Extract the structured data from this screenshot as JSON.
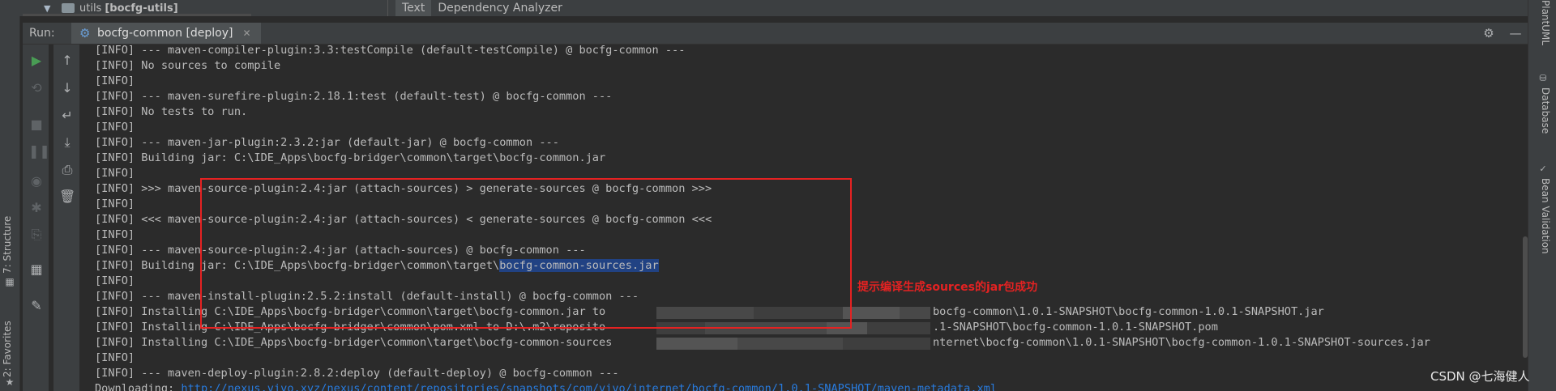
{
  "top": {
    "tree_label": "utils",
    "tree_module": "[bocfg-utils]",
    "editor_tabs": [
      "Text",
      "Dependency Analyzer"
    ]
  },
  "run": {
    "label": "Run:",
    "tab_title": "bocfg-common [deploy]"
  },
  "left_stripe": {
    "structure": "7: Structure",
    "favorites": "2: Favorites"
  },
  "right_stripe": {
    "plantuml": "PlantUML",
    "database": "Database",
    "bean_validation": "Bean Validation"
  },
  "console": {
    "lines": [
      "[INFO] --- maven-compiler-plugin:3.3:testCompile (default-testCompile) @ bocfg-common ---",
      "[INFO] No sources to compile",
      "[INFO]",
      "[INFO] --- maven-surefire-plugin:2.18.1:test (default-test) @ bocfg-common ---",
      "[INFO] No tests to run.",
      "[INFO]",
      "[INFO] --- maven-jar-plugin:2.3.2:jar (default-jar) @ bocfg-common ---",
      "[INFO] Building jar: C:\\IDE_Apps\\bocfg-bridger\\common\\target\\bocfg-common.jar",
      "[INFO]",
      "[INFO] >>> maven-source-plugin:2.4:jar (attach-sources) > generate-sources @ bocfg-common >>>",
      "[INFO]",
      "[INFO] <<< maven-source-plugin:2.4:jar (attach-sources) < generate-sources @ bocfg-common <<<",
      "[INFO]",
      "[INFO] --- maven-source-plugin:2.4:jar (attach-sources) @ bocfg-common ---",
      "[INFO] Building jar: C:\\IDE_Apps\\bocfg-bridger\\common\\target\\",
      "[INFO]",
      "[INFO] --- maven-install-plugin:2.5.2:install (default-install) @ bocfg-common ---",
      "[INFO] Installing C:\\IDE_Apps\\bocfg-bridger\\common\\target\\bocfg-common.jar to",
      "[INFO] Installing C:\\IDE_Apps\\bocfg-bridger\\common\\pom.xml to D:\\.m2\\reposito",
      "[INFO] Installing C:\\IDE_Apps\\bocfg-bridger\\common\\target\\bocfg-common-sources",
      "[INFO]",
      "[INFO] --- maven-deploy-plugin:2.8.2:deploy (default-deploy) @ bocfg-common ---",
      "Downloading: "
    ],
    "selected_text": "bocfg-common-sources.jar",
    "tail_1": "bocfg-common\\1.0.1-SNAPSHOT\\bocfg-common-1.0.1-SNAPSHOT.jar",
    "tail_2": ".1-SNAPSHOT\\bocfg-common-1.0.1-SNAPSHOT.pom",
    "tail_3": "nternet\\bocfg-common\\1.0.1-SNAPSHOT\\bocfg-common-1.0.1-SNAPSHOT-sources.jar",
    "download_url": "http://nexus.vivo.xyz/nexus/content/repositories/snapshots/com/vivo/internet/bocfg-common/1.0.1-SNAPSHOT/maven-metadata.xml"
  },
  "annotation": "提示编译生成sources的jar包成功",
  "watermark": "CSDN @七海健人",
  "colors": {
    "annotation_red": "#e52222",
    "selection": "#214283",
    "link": "#287bde",
    "run_green": "#499c54"
  }
}
